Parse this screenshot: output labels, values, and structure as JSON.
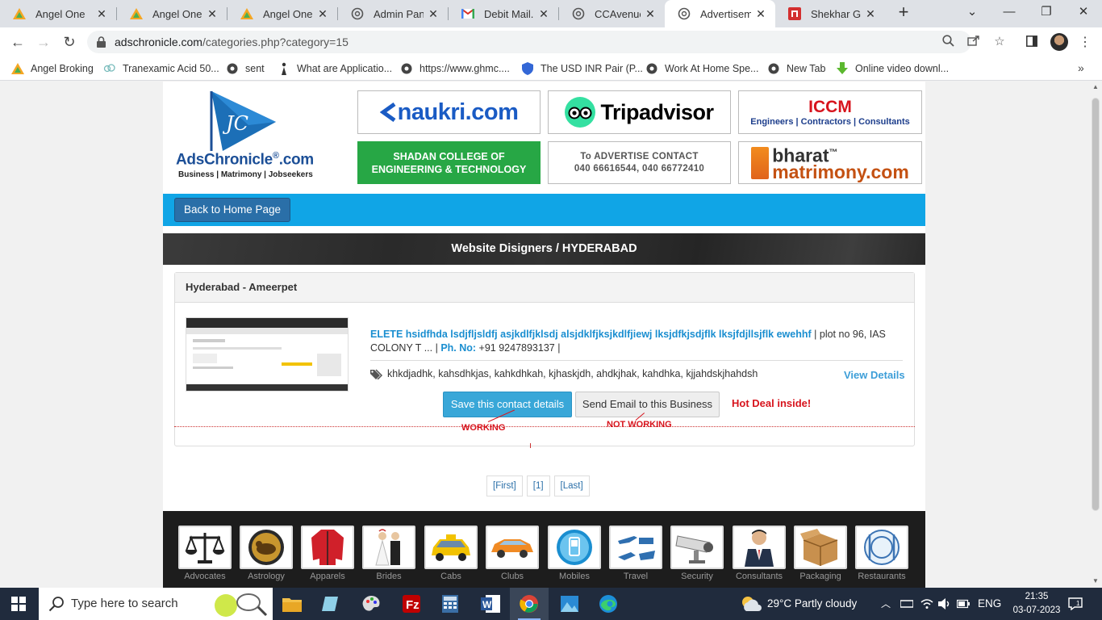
{
  "browser": {
    "tabs": [
      {
        "label": "Angel One",
        "icon": "angel-one-icon"
      },
      {
        "label": "Angel One: B",
        "icon": "angel-one-icon"
      },
      {
        "label": "Angel One: B",
        "icon": "angel-one-icon"
      },
      {
        "label": "Admin Panel",
        "icon": "globe-icon"
      },
      {
        "label": "Debit Mail.Ko",
        "icon": "gmail-icon"
      },
      {
        "label": "CCAvenue: B",
        "icon": "globe-icon"
      },
      {
        "label": "Advertisemen",
        "icon": "globe-icon",
        "active": true
      },
      {
        "label": "Shekhar Gupt",
        "icon": "red-square-icon"
      }
    ],
    "url_host": "adschronicle.com",
    "url_path": "/categories.php?category=15",
    "bookmarks": [
      "Angel Broking",
      "Tranexamic Acid 50...",
      "sent",
      "What are Applicatio...",
      "https://www.ghmc....",
      "The USD INR Pair (P...",
      "Work At Home Spe...",
      "New Tab",
      "Online video downl..."
    ]
  },
  "site": {
    "logo_name": "AdsChronicle",
    "logo_tld": ".com",
    "logo_reg": "®",
    "logo_tagline": "Business | Matrimony | Jobseekers",
    "ads": {
      "naukri": "naukri.com",
      "tripadvisor": "Tripadvisor",
      "iccm_title": "ICCM",
      "iccm_sub": "Engineers | Contractors | Consultants",
      "shadan_line1": "SHADAN COLLEGE OF",
      "shadan_line2": "ENGINEERING & TECHNOLOGY",
      "advertise_line1": "To ADVERTISE  CONTACT",
      "advertise_line2": "040 66616544, 040 66772410",
      "bharat_line1": "bharat",
      "bharat_line2": "matrimony.com",
      "bharat_tm": "™"
    },
    "home_button": "Back to Home Page",
    "section_title": "Website Disigners / HYDERABAD",
    "listing": {
      "location": "Hyderabad - Ameerpet",
      "business_name": "ELETE hsidfhda lsdjfljsldfj asjkdlfjklsdj alsjdklfjksjkdlfjiewj lksjdfkjsdjflk lksjfdjllsjflk ewehhf",
      "address": " | plot no 96, IAS COLONY T ... | ",
      "phone_label": "Ph. No:",
      "phone": " +91 9247893137 |",
      "tags": "khkdjadhk, kahsdhkjas, kahkdhkah, kjhaskjdh, ahdkjhak, kahdhka, kjjahdskjhahdsh",
      "view_details": "View Details",
      "save_button": "Save this contact details",
      "email_button": "Send Email to this Business",
      "hot_deal": "Hot Deal inside!",
      "note_working": "WORKING",
      "note_not_working": "NOT WORKING"
    },
    "pager": [
      "[First]",
      "[1]",
      "[Last]"
    ],
    "categories": [
      "Advocates",
      "Astrology",
      "Apparels",
      "Brides",
      "Cabs",
      "Clubs",
      "Mobiles",
      "Travel",
      "Security",
      "Consultants",
      "Packaging",
      "Restaurants"
    ]
  },
  "taskbar": {
    "search_placeholder": "Type here to search",
    "weather": "29°C  Partly cloudy",
    "language": "ENG",
    "time": "21:35",
    "date": "03-07-2023"
  }
}
